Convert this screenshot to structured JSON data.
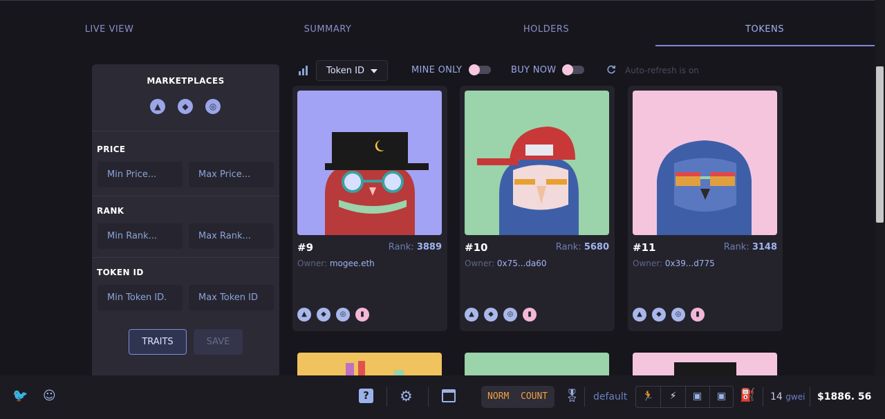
{
  "tabs": [
    {
      "label": "LIVE VIEW"
    },
    {
      "label": "SUMMARY"
    },
    {
      "label": "HOLDERS"
    },
    {
      "label": "TOKENS",
      "active": true
    }
  ],
  "sidebar": {
    "marketplaces_title": "MARKETPLACES",
    "marketplace_icons": [
      "opensea-icon",
      "looksrare-icon",
      "x2y2-icon"
    ],
    "price": {
      "label": "PRICE",
      "min_placeholder": "Min Price...",
      "max_placeholder": "Max Price..."
    },
    "rank": {
      "label": "RANK",
      "min_placeholder": "Min Rank...",
      "max_placeholder": "Max Rank..."
    },
    "token_id": {
      "label": "TOKEN ID",
      "min_placeholder": "Min Token ID.",
      "max_placeholder": "Max Token ID"
    },
    "traits_button": "TRAITS",
    "save_button": "SAVE"
  },
  "toolbar": {
    "sort_selected": "Token ID",
    "mine_only_label": "MINE ONLY",
    "mine_only_on": false,
    "buy_now_label": "BUY NOW",
    "buy_now_on": false,
    "auto_refresh_text": "Auto-refresh is on"
  },
  "cards": [
    {
      "token": "#9",
      "rank_label": "Rank:",
      "rank": "3889",
      "owner_label": "Owner:",
      "owner": "mogee.eth",
      "bg": "#a3a3f5"
    },
    {
      "token": "#10",
      "rank_label": "Rank:",
      "rank": "5680",
      "owner_label": "Owner:",
      "owner": "0x75...da60",
      "bg": "#9bd3aa"
    },
    {
      "token": "#11",
      "rank_label": "Rank:",
      "rank": "3148",
      "owner_label": "Owner:",
      "owner": "0x39...d775",
      "bg": "#f5c5de"
    }
  ],
  "next_row_backgrounds": [
    "#f0c35e",
    "#9bd3aa",
    "#f5c5de"
  ],
  "bottom_bar": {
    "norm_label": "NORM",
    "count_label": "COUNT",
    "profile": "default",
    "gas_value": "14",
    "gas_unit": "gwei",
    "eth_price": "$1886. 56"
  },
  "colors": {
    "background": "#17161c",
    "panel": "#2b2a35",
    "accent": "#7f88d8",
    "link": "#9fb4f0"
  }
}
